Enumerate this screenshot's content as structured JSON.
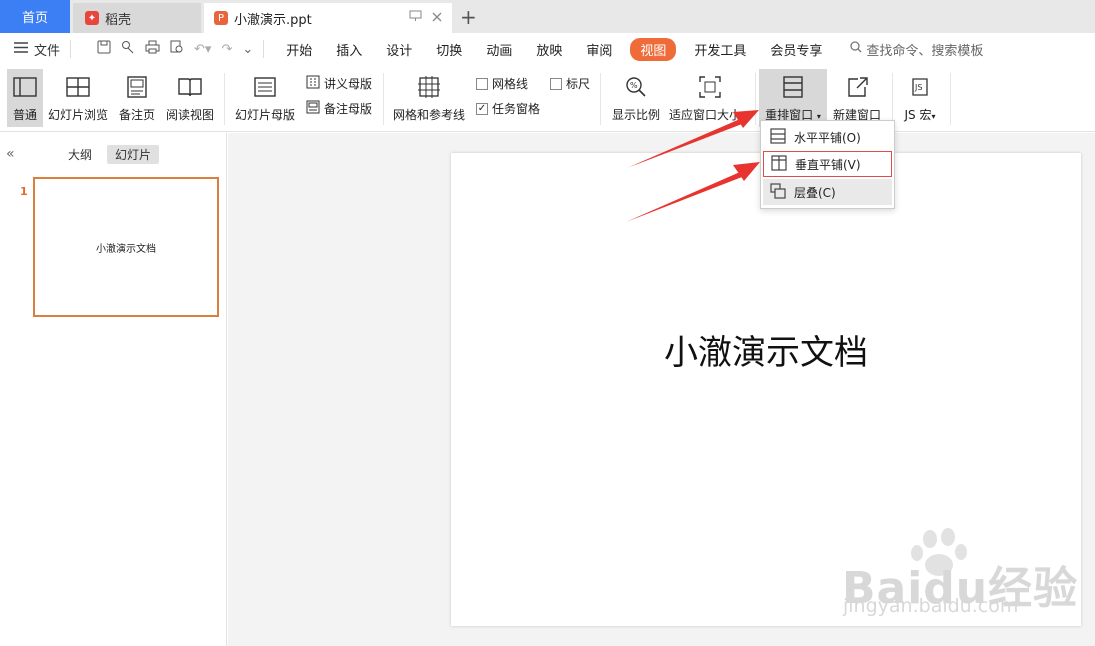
{
  "tabs": {
    "home": "首页",
    "daoke": "稻壳",
    "document": "小澈演示.ppt",
    "doc_icon_letter": "P"
  },
  "menubar": {
    "file": "文件",
    "menus": [
      "开始",
      "插入",
      "设计",
      "切换",
      "动画",
      "放映",
      "审阅",
      "视图",
      "开发工具",
      "会员专享"
    ],
    "active_menu": "视图",
    "search": "查找命令、搜索模板"
  },
  "ribbon": {
    "normal": "普通",
    "slide_sorter": "幻灯片浏览",
    "notes_page": "备注页",
    "reading_view": "阅读视图",
    "slide_master": "幻灯片母版",
    "handout_master": "讲义母版",
    "notes_master": "备注母版",
    "grid_guides": "网格和参考线",
    "gridlines": "网格线",
    "gridlines_checked": false,
    "ruler": "标尺",
    "ruler_checked": false,
    "task_pane": "任务窗格",
    "task_pane_checked": true,
    "zoom": "显示比例",
    "fit_window": "适应窗口大小",
    "arrange_windows": "重排窗口",
    "new_window": "新建窗口",
    "js_macro": "JS 宏"
  },
  "dropdown": {
    "items": [
      "水平平铺(O)",
      "垂直平铺(V)",
      "层叠(C)"
    ]
  },
  "left_panel": {
    "tab_outline": "大纲",
    "tab_slides": "幻灯片",
    "slide_number": "1",
    "thumb_text": "小澈演示文档"
  },
  "slide": {
    "title": "小澈演示文档"
  },
  "watermark": {
    "text": "Baidu经验",
    "sub": "jingyan.baidu.com"
  },
  "colors": {
    "accent_blue": "#3c7ef3",
    "active_menu_orange": "#ef6c3a",
    "thumb_border": "#d9803f",
    "arrow_red": "#e8342e"
  }
}
